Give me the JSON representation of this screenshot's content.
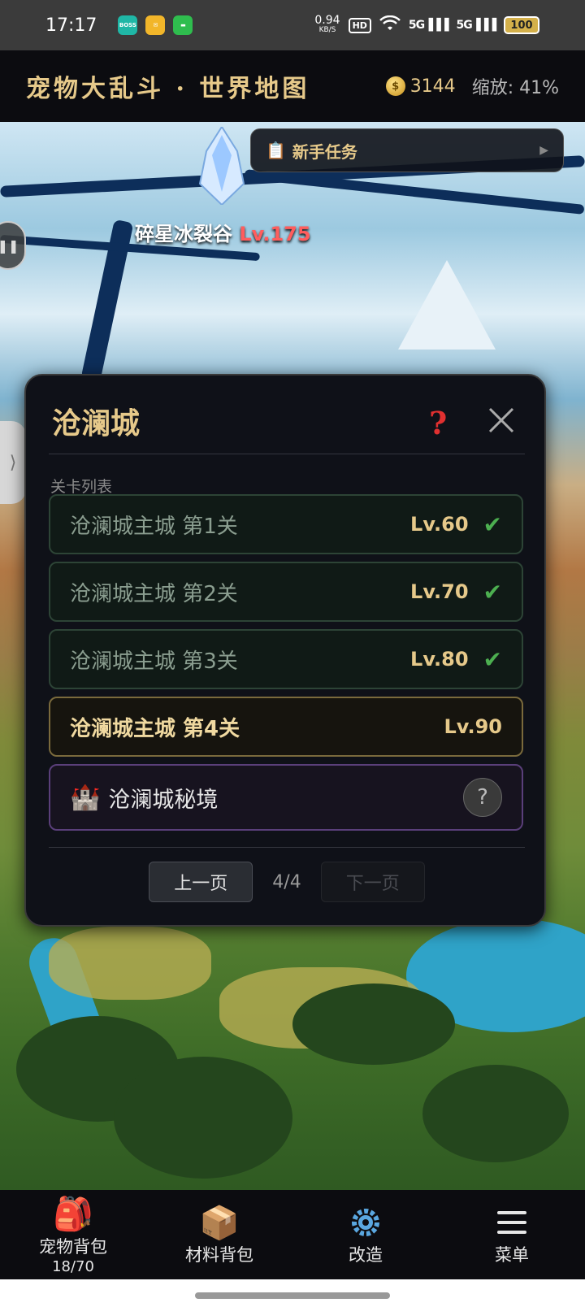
{
  "status_bar": {
    "time": "17:17",
    "app_icons": [
      "boss-app-icon",
      "mail-app-icon",
      "chat-app-icon"
    ],
    "net_speed": "0.94",
    "net_unit": "KB/S",
    "hd_badge": "HD",
    "signal1": "5G",
    "signal2": "5G",
    "battery": "100"
  },
  "header": {
    "title": "宠物大乱斗 · 世界地图",
    "gold": "3144",
    "zoom": "缩放: 41%"
  },
  "map": {
    "labels": [
      {
        "name": "碎星冰裂谷",
        "lv": "Lv.175"
      }
    ]
  },
  "quest": {
    "label": "新手任务"
  },
  "dialog": {
    "title": "沧澜城",
    "list_label": "关卡列表",
    "stages": [
      {
        "name": "沧澜城主城 第1关",
        "lv": "Lv.60",
        "cleared": true
      },
      {
        "name": "沧澜城主城 第2关",
        "lv": "Lv.70",
        "cleared": true
      },
      {
        "name": "沧澜城主城 第3关",
        "lv": "Lv.80",
        "cleared": true
      },
      {
        "name": "沧澜城主城 第4关",
        "lv": "Lv.90",
        "cleared": false
      }
    ],
    "secret": {
      "name": "沧澜城秘境",
      "help": "?"
    },
    "pager": {
      "prev": "上一页",
      "page": "4/4",
      "next": "下一页"
    }
  },
  "bottom_nav": {
    "items": [
      {
        "label": "宠物背包",
        "count": "18/70",
        "icon": "backpack-icon"
      },
      {
        "label": "材料背包",
        "icon": "box-icon"
      },
      {
        "label": "改造",
        "icon": "gear-icon"
      },
      {
        "label": "菜单",
        "icon": "menu-icon"
      }
    ]
  }
}
